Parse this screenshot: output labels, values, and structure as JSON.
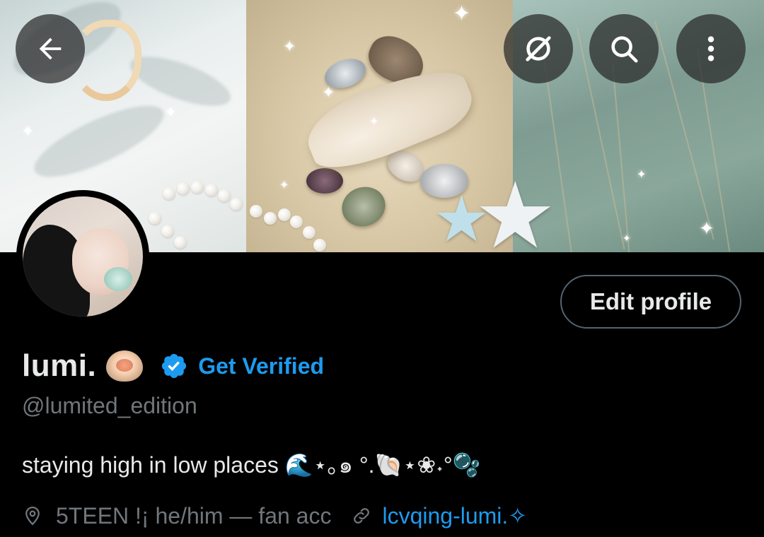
{
  "header": {
    "back_icon": "arrow-left-icon",
    "grok_icon": "grok-icon",
    "search_icon": "search-icon",
    "more_icon": "more-vertical-icon"
  },
  "profile": {
    "display_name": "lumi.",
    "name_emoji": "oyster-emoji",
    "get_verified_label": "Get Verified",
    "handle": "@lumited_edition",
    "bio": "staying high in low places 🌊⋆｡๑ °.🐚⋆❀˖°🫧",
    "location": "5TEEN !¡ he/him — fan acc",
    "url": "lcvqing-lumi.✧",
    "edit_profile_label": "Edit profile"
  },
  "colors": {
    "background": "#000000",
    "text_primary": "#e7e9ea",
    "text_secondary": "#71767b",
    "accent": "#1d9bf0",
    "button_border": "#536471"
  }
}
